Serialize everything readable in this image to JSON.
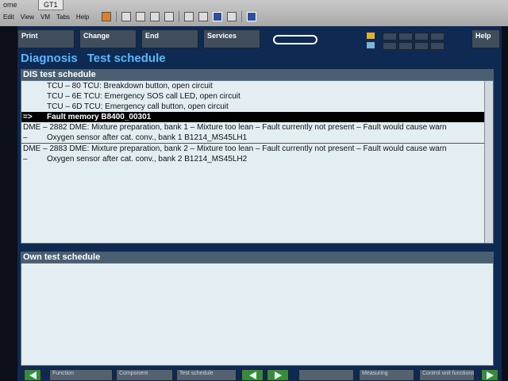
{
  "vm": {
    "tab_left": "ome",
    "tab": "GT1",
    "menu": [
      "Edit",
      "View",
      "VM",
      "Tabs",
      "Help"
    ]
  },
  "top_buttons": [
    {
      "label": "Print"
    },
    {
      "label": "Change"
    },
    {
      "label": "End"
    },
    {
      "label": "Services"
    },
    {
      "label": "Help"
    }
  ],
  "heading": {
    "left": "Diagnosis",
    "right": "Test schedule"
  },
  "dis_panel": {
    "title": "DIS test schedule",
    "rows": [
      {
        "pre": "",
        "text": "TCU – 80 TCU: Breakdown button, open circuit"
      },
      {
        "pre": "",
        "text": "TCU – 6E TCU: Emergency SOS call LED, open circuit"
      },
      {
        "pre": "",
        "text": "TCU – 6D TCU: Emergency call button, open circuit"
      },
      {
        "pre": "=>",
        "text": "Fault memory  B8400_00301"
      },
      {
        "pre": "",
        "text": "DME – 2882 DME: Mixture preparation, bank 1 – Mixture too lean  – Fault currently not present – Fault would cause warn"
      },
      {
        "pre": "–",
        "text": "Oxygen sensor after cat. conv., bank 1  B1214_MS45LH1"
      },
      {
        "pre": "",
        "text": "DME – 2883 DME: Mixture preparation, bank 2 – Mixture too lean  – Fault currently not present – Fault would cause warn"
      },
      {
        "pre": "–",
        "text": "Oxygen sensor after cat. conv., bank 2  B1214_MS45LH2"
      }
    ]
  },
  "own_panel": {
    "title": "Own test schedule"
  },
  "bottom_buttons": [
    {
      "label": "Function"
    },
    {
      "label": "Component"
    },
    {
      "label": "Test schedule"
    },
    {
      "label": "Measuring"
    },
    {
      "label": "Control unit functions"
    }
  ]
}
